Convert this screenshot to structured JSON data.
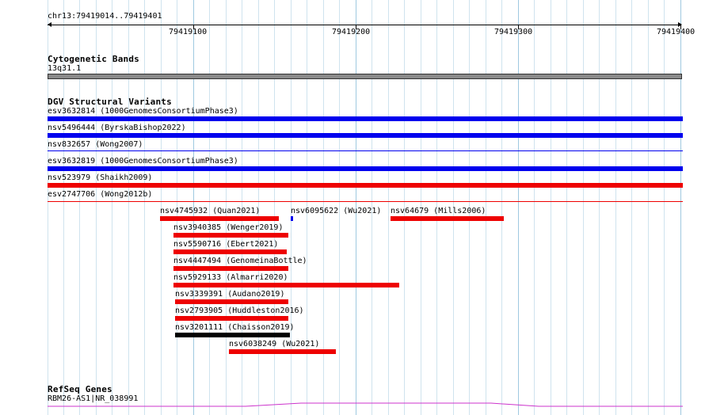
{
  "ruler": {
    "region_label": "chr13:79419014..79419401",
    "ticks": [
      {
        "label": "79419100"
      },
      {
        "label": "79419200"
      },
      {
        "label": "79419300"
      },
      {
        "label": "79419400"
      }
    ]
  },
  "cytoband": {
    "title": "Cytogenetic Bands",
    "band_label": "13q31.1",
    "color": "#8a8a8a"
  },
  "dgv": {
    "title": "DGV Structural Variants",
    "colors": {
      "gain": "#0000ee",
      "loss": "#ee0000",
      "complex": "#000000"
    },
    "full_width_features": [
      {
        "label": "esv3632814 (1000GenomesConsortiumPhase3)",
        "type": "gain"
      },
      {
        "label": "nsv5496444 (ByrskaBishop2022)",
        "type": "gain"
      },
      {
        "label": "nsv832657 (Wong2007)",
        "type": "gain"
      },
      {
        "label": "esv3632819 (1000GenomesConsortiumPhase3)",
        "type": "gain"
      },
      {
        "label": "nsv523979 (Shaikh2009)",
        "type": "loss"
      },
      {
        "label": "esv2747706 (Wong2012b)",
        "type": "loss"
      }
    ],
    "features": [
      {
        "label": "nsv4745932 (Quan2021)",
        "type": "loss"
      },
      {
        "label": "nsv6095622 (Wu2021)",
        "type": "gain"
      },
      {
        "label": "nsv64679 (Mills2006)",
        "type": "loss"
      },
      {
        "label": "nsv3940385 (Wenger2019)",
        "type": "loss"
      },
      {
        "label": "nsv5590716 (Ebert2021)",
        "type": "loss"
      },
      {
        "label": "nsv4447494 (GenomeinaBottle)",
        "type": "loss"
      },
      {
        "label": "nsv5929133 (Almarri2020)",
        "type": "loss"
      },
      {
        "label": "nsv3339391 (Audano2019)",
        "type": "loss"
      },
      {
        "label": "nsv2793905 (Huddleston2016)",
        "type": "loss"
      },
      {
        "label": "nsv3201111 (Chaisson2019)",
        "type": "complex"
      },
      {
        "label": "nsv6038249 (Wu2021)",
        "type": "loss"
      }
    ]
  },
  "refseq": {
    "title": "RefSeq Genes",
    "gene_label": "RBM26-AS1|NR_038991",
    "color": "#cc33cc"
  }
}
